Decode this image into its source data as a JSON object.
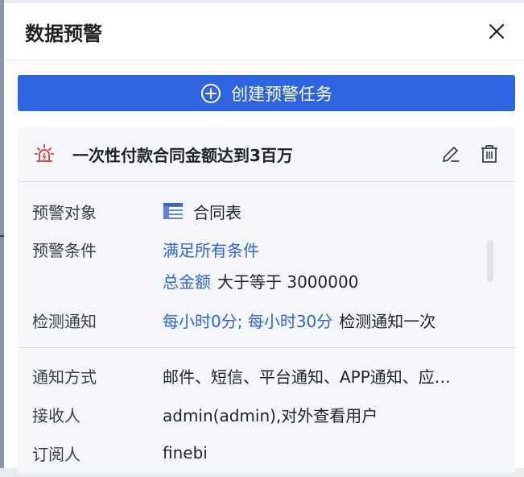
{
  "panel": {
    "title": "数据预警"
  },
  "toolbar": {
    "create_label": "创建预警任务"
  },
  "task": {
    "name": "一次性付款合同金额达到3百万",
    "details": {
      "object_label": "预警对象",
      "object_value": "合同表",
      "condition_label": "预警条件",
      "condition_mode": "满足所有条件",
      "condition_field": "总金额",
      "condition_rule": "大于等于 3000000",
      "check_label": "检测通知",
      "check_schedule": "每小时0分; 每小时30分",
      "check_suffix": "检测通知一次"
    },
    "notify": {
      "method_label": "通知方式",
      "method_value": "邮件、短信、平台通知、APP通知、应…",
      "recipient_label": "接收人",
      "recipient_value": "admin(admin),对外查看用户",
      "subscriber_label": "订阅人",
      "subscriber_value": "finebi"
    }
  },
  "colors": {
    "accent": "#2e64e0",
    "alarm": "#e04b4b",
    "card_bg": "#f4f6f9"
  }
}
